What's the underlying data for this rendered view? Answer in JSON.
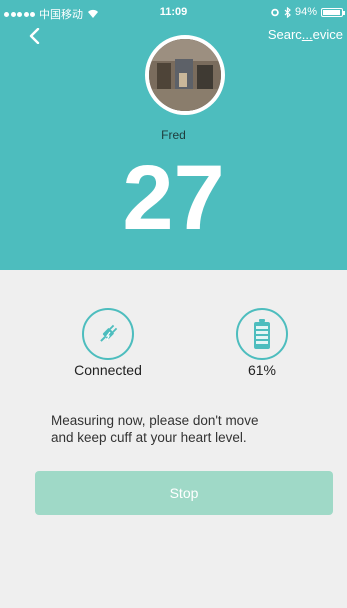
{
  "status_bar": {
    "carrier": "中国移动",
    "time": "11:09",
    "battery_percent": "94%"
  },
  "nav": {
    "back_icon": "chevron-left-icon",
    "search_label_start": "Searc",
    "search_label_end": "evice"
  },
  "user": {
    "name": "Fred"
  },
  "measurement": {
    "value": "27"
  },
  "device": {
    "connection_status": "Connected",
    "battery_level": "61%",
    "connection_icon": "plug-icon",
    "battery_icon": "battery-icon"
  },
  "message": {
    "line1": "Measuring now, please don't move",
    "line2": "and keep cuff at your heart level."
  },
  "actions": {
    "stop_label": "Stop"
  },
  "colors": {
    "primary": "#4dbdbe",
    "button": "#9fd9c7",
    "background": "#efefef"
  }
}
